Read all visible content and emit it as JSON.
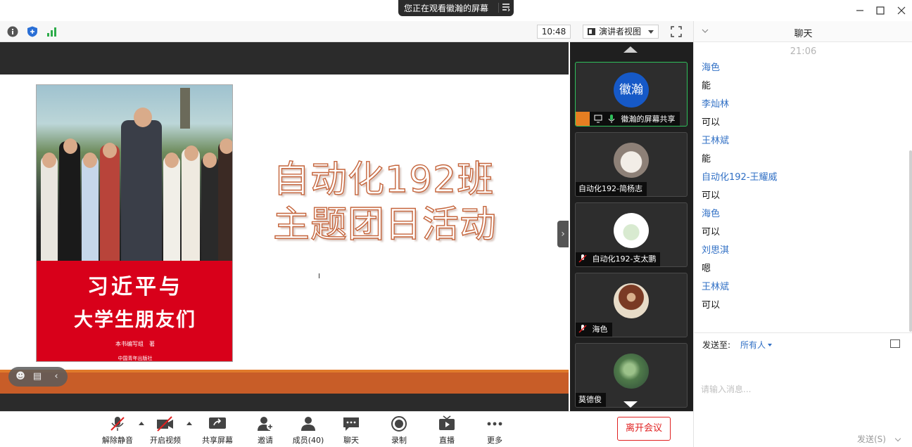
{
  "banner": {
    "text": "您正在观看徽瀚的屏幕"
  },
  "toolbar": {
    "time": "10:48",
    "view_label": "演讲者视图"
  },
  "slide": {
    "title_line1": "自动化192班",
    "title_line2": "主题团日活动",
    "book_title_line1": "习近平与",
    "book_title_line2": "大学生朋友们",
    "book_author": "本书编写组　著",
    "book_publisher": "中国青年出版社"
  },
  "gallery": {
    "tiles": [
      {
        "label": "徽瀚的屏幕共享",
        "avatar_text": "徽瀚",
        "active": true
      },
      {
        "label": "自动化192-简杨志"
      },
      {
        "label": "自动化192-支太鹏"
      },
      {
        "label": "海色"
      },
      {
        "label": "莫德俊"
      }
    ]
  },
  "chat": {
    "title": "聊天",
    "time": "21:06",
    "messages": [
      {
        "name": "海色",
        "text": "能"
      },
      {
        "name": "李灿林",
        "text": "可以"
      },
      {
        "name": "王林斌",
        "text": "能"
      },
      {
        "name": "自动化192-王耀威",
        "text": "可以"
      },
      {
        "name": "海色",
        "text": "可以"
      },
      {
        "name": "刘思淇",
        "text": "嗯"
      },
      {
        "name": "王林斌",
        "text": "可以"
      }
    ],
    "send_to_label": "发送至:",
    "send_to_value": "所有人",
    "input_placeholder": "请输入消息...",
    "send_button": "发送(S)"
  },
  "controls": {
    "unmute": "解除静音",
    "start_video": "开启视频",
    "share_screen": "共享屏幕",
    "invite": "邀请",
    "members": "成员(40)",
    "chat": "聊天",
    "record": "录制",
    "live": "直播",
    "more": "更多",
    "leave": "离开会议"
  },
  "colors": {
    "accent_blue": "#3170c5",
    "leave_red": "#e02020",
    "active_green": "#2fbf5b",
    "slide_bar": "#c85d28"
  }
}
